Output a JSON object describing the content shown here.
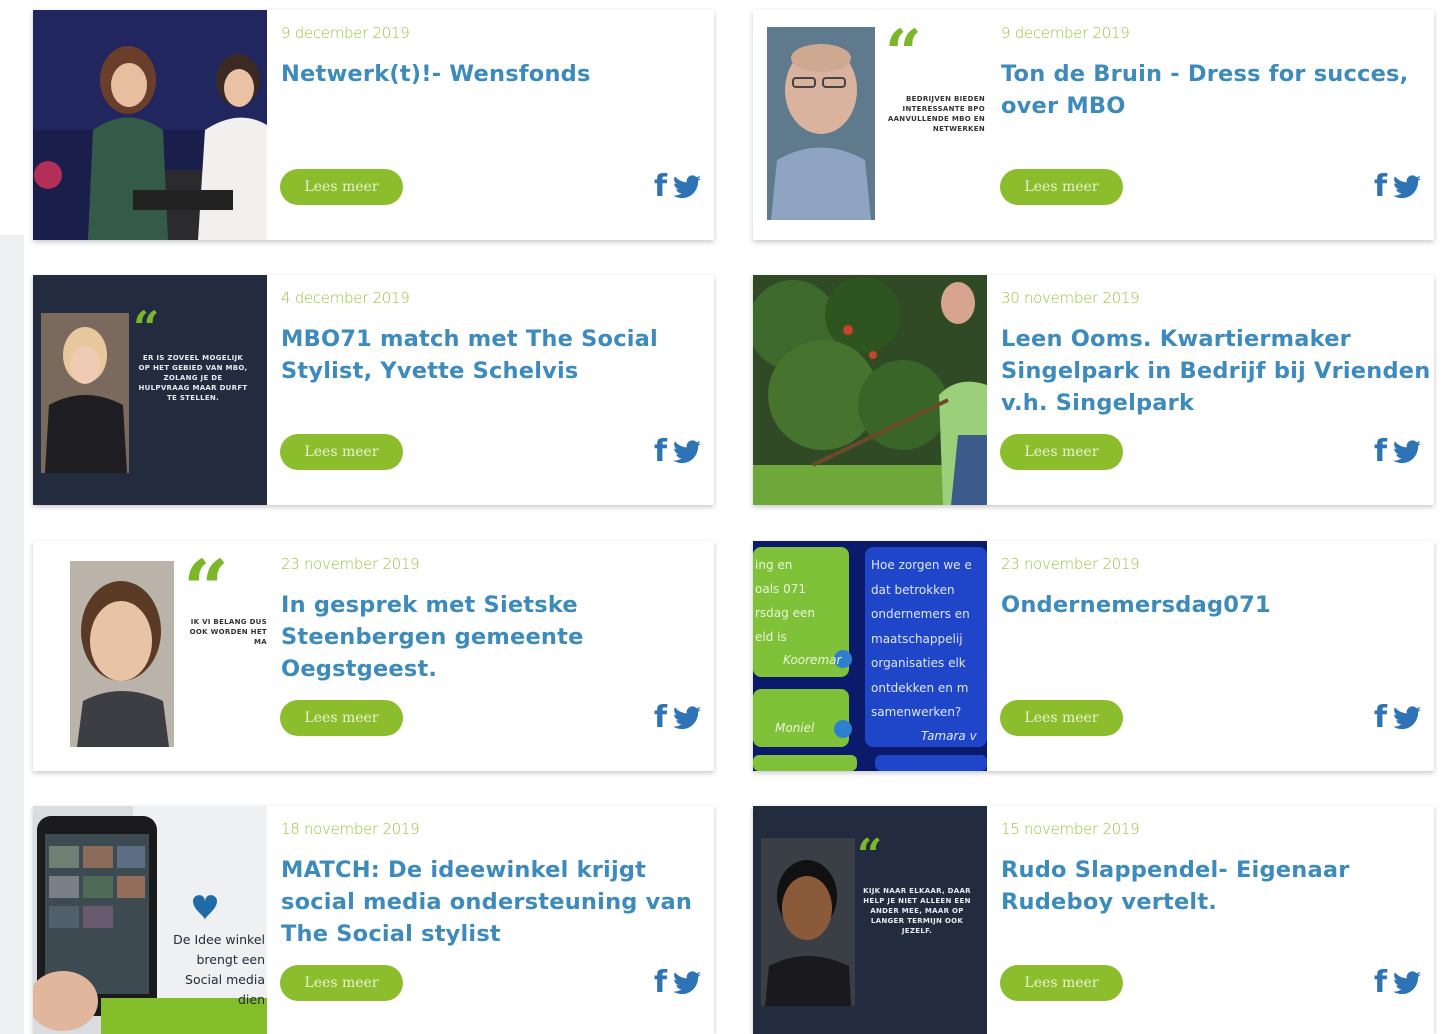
{
  "read_more": "Lees meer",
  "cards": [
    {
      "date": "9 december 2019",
      "title": "Netwerk(t)!- Wensfonds"
    },
    {
      "date": "9 december 2019",
      "title": "Ton de Bruin - Dress for succes, over MBO",
      "quote_text": "BEDRIJVEN BIEDEN INTERESSANTE BPO AANVULLENDE MBO EN NETWERKEN"
    },
    {
      "date": "4 december 2019",
      "title": "MBO71 match met The Social Stylist, Yvette Schelvis",
      "quote_text": "ER IS ZOVEEL MOGELIJK OP HET GEBIED VAN MBO, ZOLANG JE DE HULPVRAAG MAAR DURFT TE STELLEN."
    },
    {
      "date": "30 november 2019",
      "title": "Leen Ooms. Kwartiermaker Singelpark in Bedrijf bij Vrienden v.h. Singelpark"
    },
    {
      "date": "23 november 2019",
      "title": "In gesprek met Sietske Steenbergen gemeente Oegstgeest.",
      "quote_text": "IK VI BELANG DUS OOK WORDEN HET MA"
    },
    {
      "date": "23 november 2019",
      "title": "Ondernemersdag071",
      "chat_left": [
        "ing en",
        "oals 071",
        "rsdag een",
        "eld is"
      ],
      "chat_left_name_1": "Kooremar",
      "chat_left_name_2": "Moniel",
      "chat_right": [
        "Hoe zorgen we e",
        "dat betrokken",
        "ondernemers en",
        "maatschappelij",
        "organisaties elk",
        "ontdekken en m",
        "samenwerken?"
      ],
      "chat_right_name": "Tamara v"
    },
    {
      "date": "18 november 2019",
      "title": "MATCH: De ideewinkel krijgt social media ondersteuning van The Social stylist",
      "photo_caption": [
        "De Idee winkel",
        "brengt een",
        "Social media dien"
      ]
    },
    {
      "date": "15 november 2019",
      "title": "Rudo Slappendel- Eigenaar Rudeboy vertelt.",
      "quote_text": "KIJK NAAR ELKAAR, DAAR HELP JE NIET ALLEEN EEN ANDER MEE, MAAR OP LANGER TERMIJN OOK JEZELF."
    }
  ],
  "social": {
    "facebook": "f",
    "icons": [
      "facebook-icon",
      "twitter-icon"
    ]
  },
  "colors": {
    "title": "#3d8bbd",
    "date": "#9cc23a",
    "button": "#8cbd2d",
    "social": "#2d73b6",
    "navy": "#232c3f"
  }
}
